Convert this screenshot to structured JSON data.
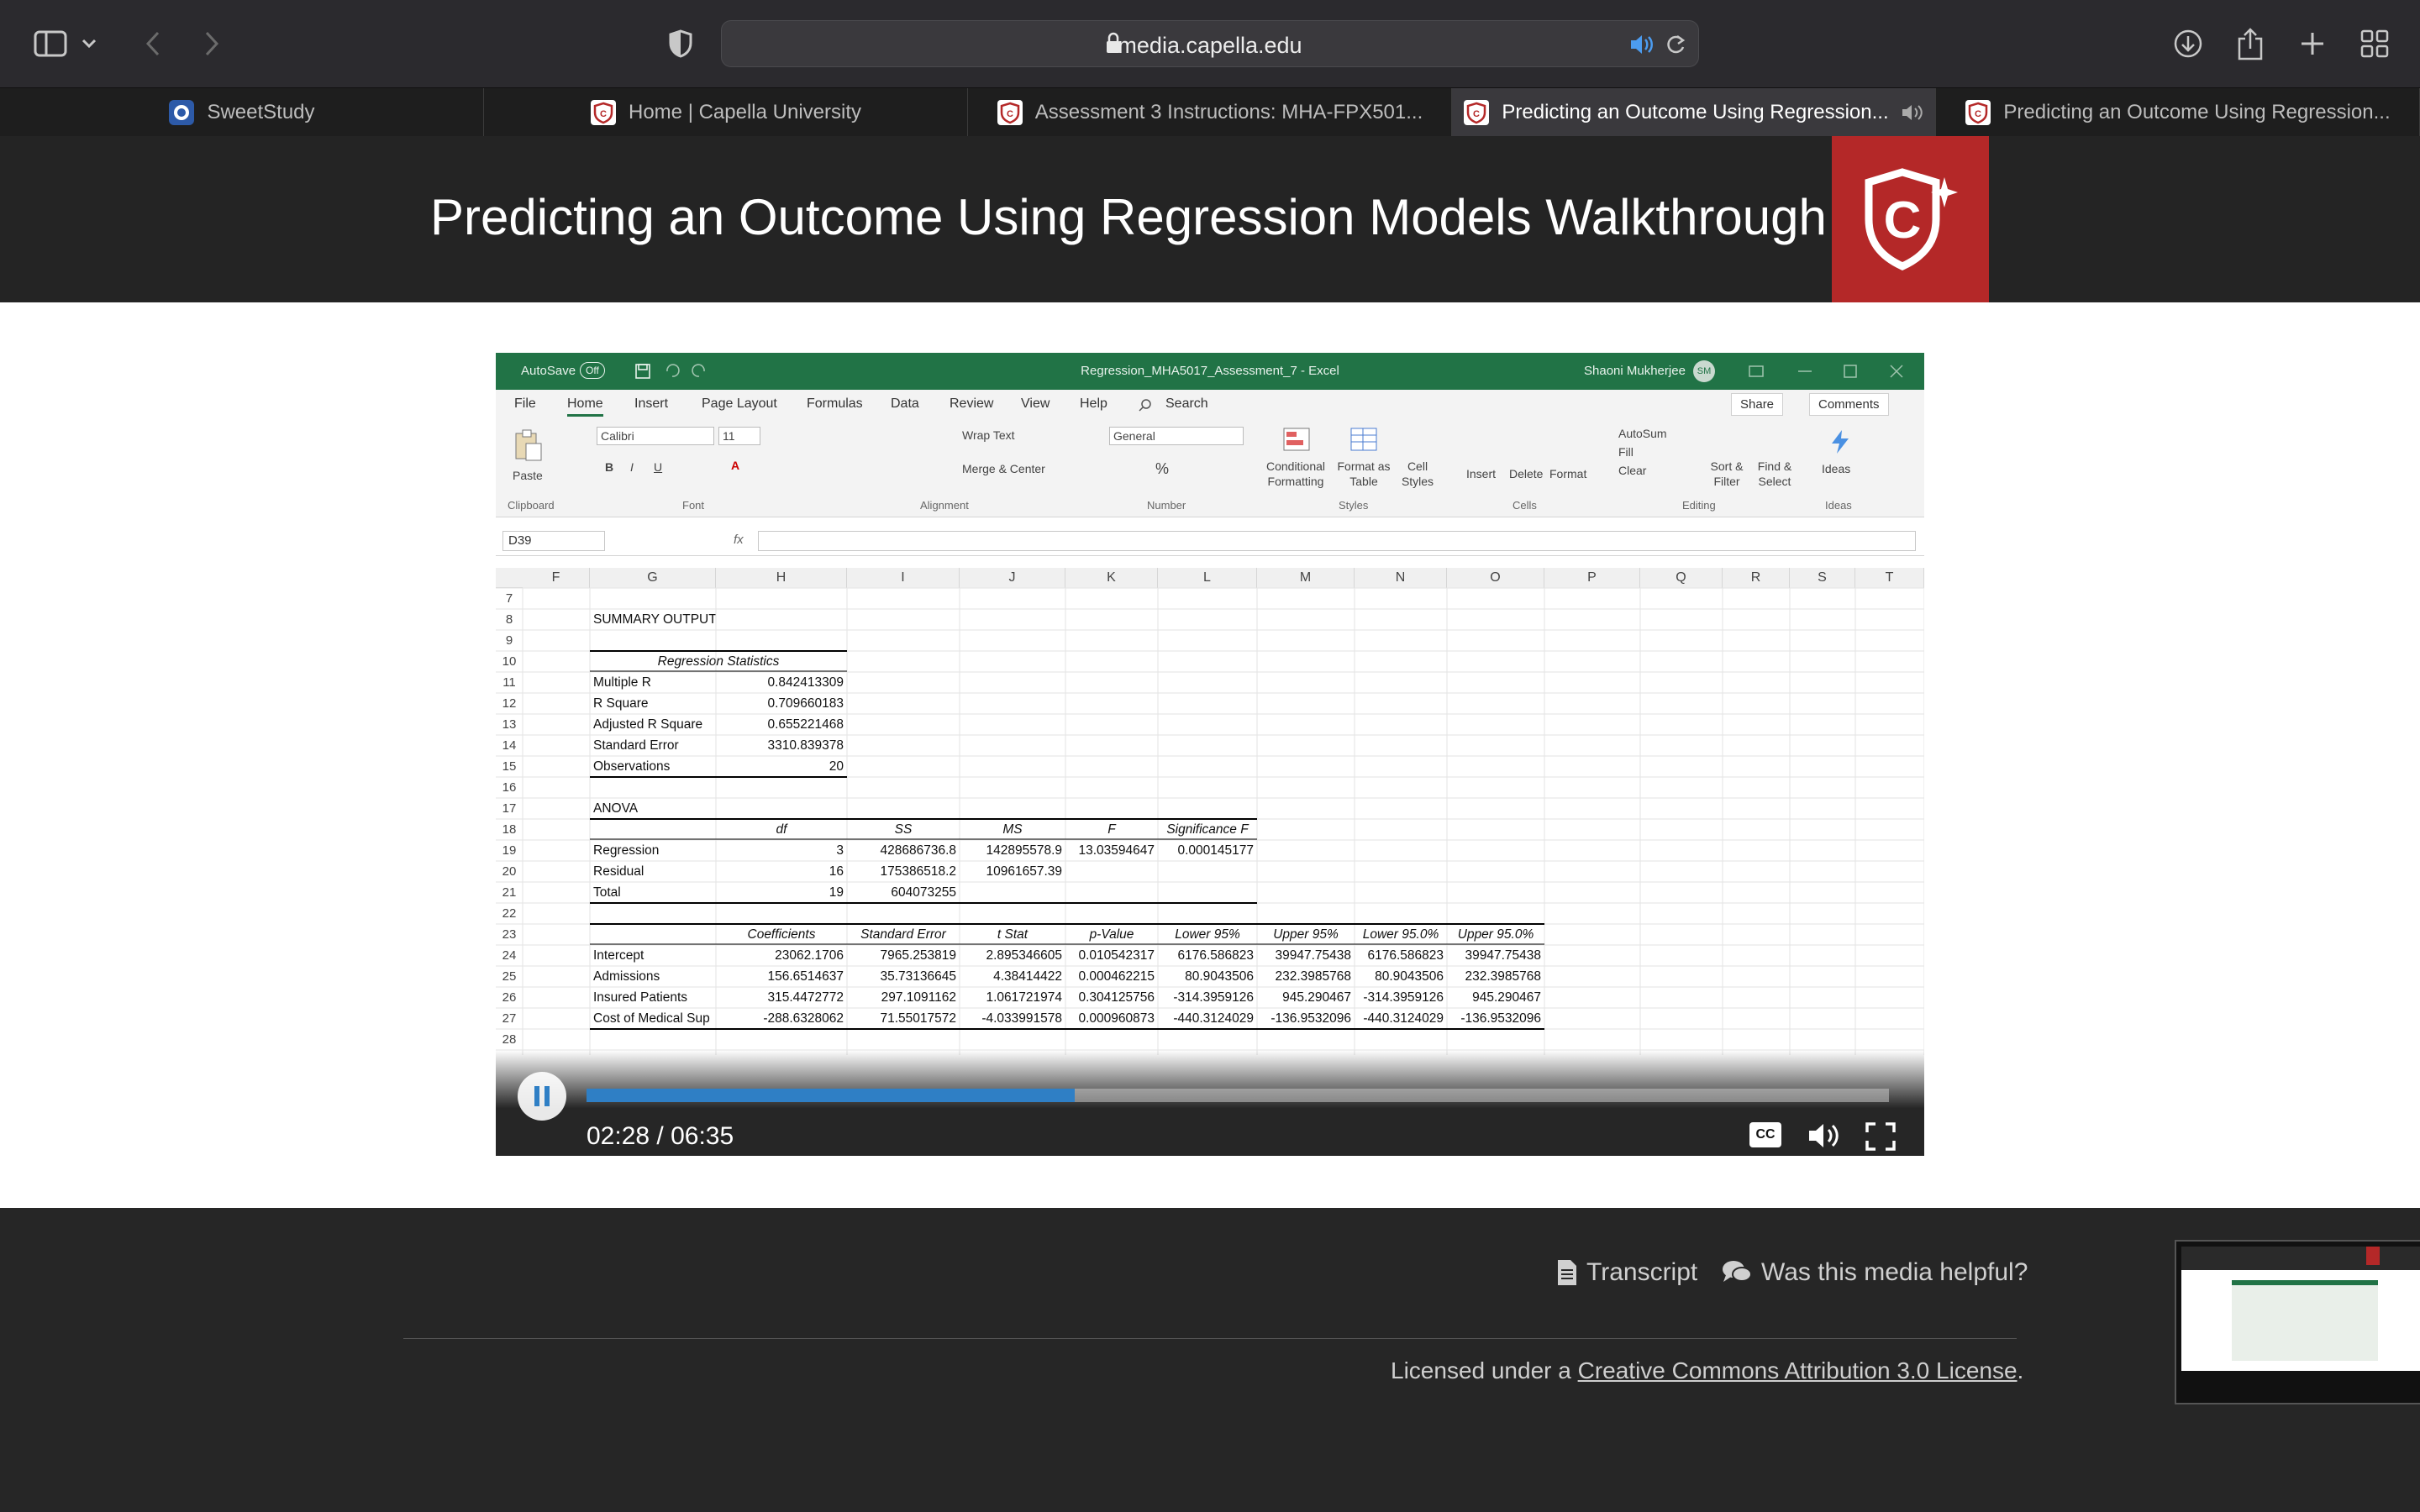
{
  "browser": {
    "url": "media.capella.edu",
    "tabs": [
      {
        "title": "SweetStudy",
        "active": false,
        "favicon": "sweetstudy-icon",
        "muted_icon": false
      },
      {
        "title": "Home | Capella University",
        "active": false,
        "favicon": "capella-icon",
        "muted_icon": false
      },
      {
        "title": "Assessment 3 Instructions: MHA-FPX501...",
        "active": false,
        "favicon": "capella-icon",
        "muted_icon": false
      },
      {
        "title": "Predicting an Outcome Using Regression...",
        "active": true,
        "favicon": "capella-icon",
        "muted_icon": true
      },
      {
        "title": "Predicting an Outcome Using Regression...",
        "active": false,
        "favicon": "capella-icon",
        "muted_icon": false
      }
    ]
  },
  "header": {
    "title": "Predicting an Outcome Using Regression Models Walkthrough",
    "logo": "capella-shield-logo",
    "logo_color": "#b42828"
  },
  "excel": {
    "autosave_label": "AutoSave",
    "autosave_state": "Off",
    "window_title": "Regression_MHA5017_Assessment_7 - Excel",
    "user_name": "Shaoni Mukherjee",
    "user_initials": "SM",
    "menu_tabs": [
      "File",
      "Home",
      "Insert",
      "Page Layout",
      "Formulas",
      "Data",
      "Review",
      "View",
      "Help"
    ],
    "active_tab": "Home",
    "search_label": "Search",
    "share_label": "Share",
    "comments_label": "Comments",
    "ribbon": {
      "paste": "Paste",
      "font_name": "Calibri",
      "font_size": "11",
      "wrap_text": "Wrap Text",
      "merge_center": "Merge & Center",
      "number_format": "General",
      "conditional_formatting": "Conditional Formatting",
      "format_as_table": "Format as Table",
      "cell_styles": "Cell Styles",
      "insert": "Insert",
      "delete": "Delete",
      "format": "Format",
      "autosum": "AutoSum",
      "fill": "Fill",
      "clear": "Clear",
      "sort_filter": "Sort & Filter",
      "find_select": "Find & Select",
      "ideas": "Ideas",
      "groups": [
        "Clipboard",
        "Font",
        "Alignment",
        "Number",
        "Styles",
        "Cells",
        "Editing",
        "Ideas"
      ]
    },
    "name_box": "D39",
    "fx": "fx",
    "columns": [
      "F",
      "G",
      "H",
      "I",
      "J",
      "K",
      "L",
      "M",
      "N",
      "O",
      "P",
      "Q",
      "R",
      "S",
      "T"
    ],
    "row_numbers": [
      "7",
      "8",
      "9",
      "10",
      "11",
      "12",
      "13",
      "14",
      "15",
      "16",
      "17",
      "18",
      "19",
      "20",
      "21",
      "22",
      "23",
      "24",
      "25",
      "26",
      "27",
      "28"
    ],
    "summary_output": "SUMMARY OUTPUT",
    "regression_statistics": {
      "heading": "Regression Statistics",
      "rows": [
        {
          "label": "Multiple R",
          "value": "0.842413309"
        },
        {
          "label": "R Square",
          "value": "0.709660183"
        },
        {
          "label": "Adjusted R Square",
          "value": "0.655221468"
        },
        {
          "label": "Standard Error",
          "value": "3310.839378"
        },
        {
          "label": "Observations",
          "value": "20"
        }
      ]
    },
    "anova": {
      "heading": "ANOVA",
      "headers": [
        "df",
        "SS",
        "MS",
        "F",
        "Significance F"
      ],
      "rows": [
        {
          "label": "Regression",
          "cells": [
            "3",
            "428686736.8",
            "142895578.9",
            "13.03594647",
            "0.000145177"
          ]
        },
        {
          "label": "Residual",
          "cells": [
            "16",
            "175386518.2",
            "10961657.39",
            "",
            ""
          ]
        },
        {
          "label": "Total",
          "cells": [
            "19",
            "604073255",
            "",
            "",
            ""
          ]
        }
      ]
    },
    "coefficients": {
      "headers": [
        "Coefficients",
        "Standard Error",
        "t Stat",
        "p-Value",
        "Lower 95%",
        "Upper 95%",
        "Lower 95.0%",
        "Upper 95.0%"
      ],
      "rows": [
        {
          "label": "Intercept",
          "cells": [
            "23062.1706",
            "7965.253819",
            "2.895346605",
            "0.010542317",
            "6176.586823",
            "39947.75438",
            "6176.586823",
            "39947.75438"
          ]
        },
        {
          "label": "Admissions",
          "cells": [
            "156.6514637",
            "35.73136645",
            "4.38414422",
            "0.000462215",
            "80.9043506",
            "232.3985768",
            "80.9043506",
            "232.3985768"
          ]
        },
        {
          "label": "Insured Patients",
          "cells": [
            "315.4472772",
            "297.1091162",
            "1.061721974",
            "0.304125756",
            "-314.3959126",
            "945.290467",
            "-314.3959126",
            "945.290467"
          ]
        },
        {
          "label": "Cost of Medical Sup",
          "cells": [
            "-288.6328062",
            "71.55017572",
            "-4.033991578",
            "0.000960873",
            "-440.3124029",
            "-136.9532096",
            "-440.3124029",
            "-136.9532096"
          ]
        }
      ]
    }
  },
  "player": {
    "time_display": "02:28 / 06:35",
    "progress_fraction": 0.3747,
    "cc_label": "CC",
    "accent_color": "#2f7fc5"
  },
  "footer": {
    "transcript": "Transcript",
    "helpful": "Was this media helpful?",
    "license_prefix": "Licensed under a ",
    "license_link": "Creative Commons Attribution 3.0 License",
    "license_suffix": "."
  }
}
